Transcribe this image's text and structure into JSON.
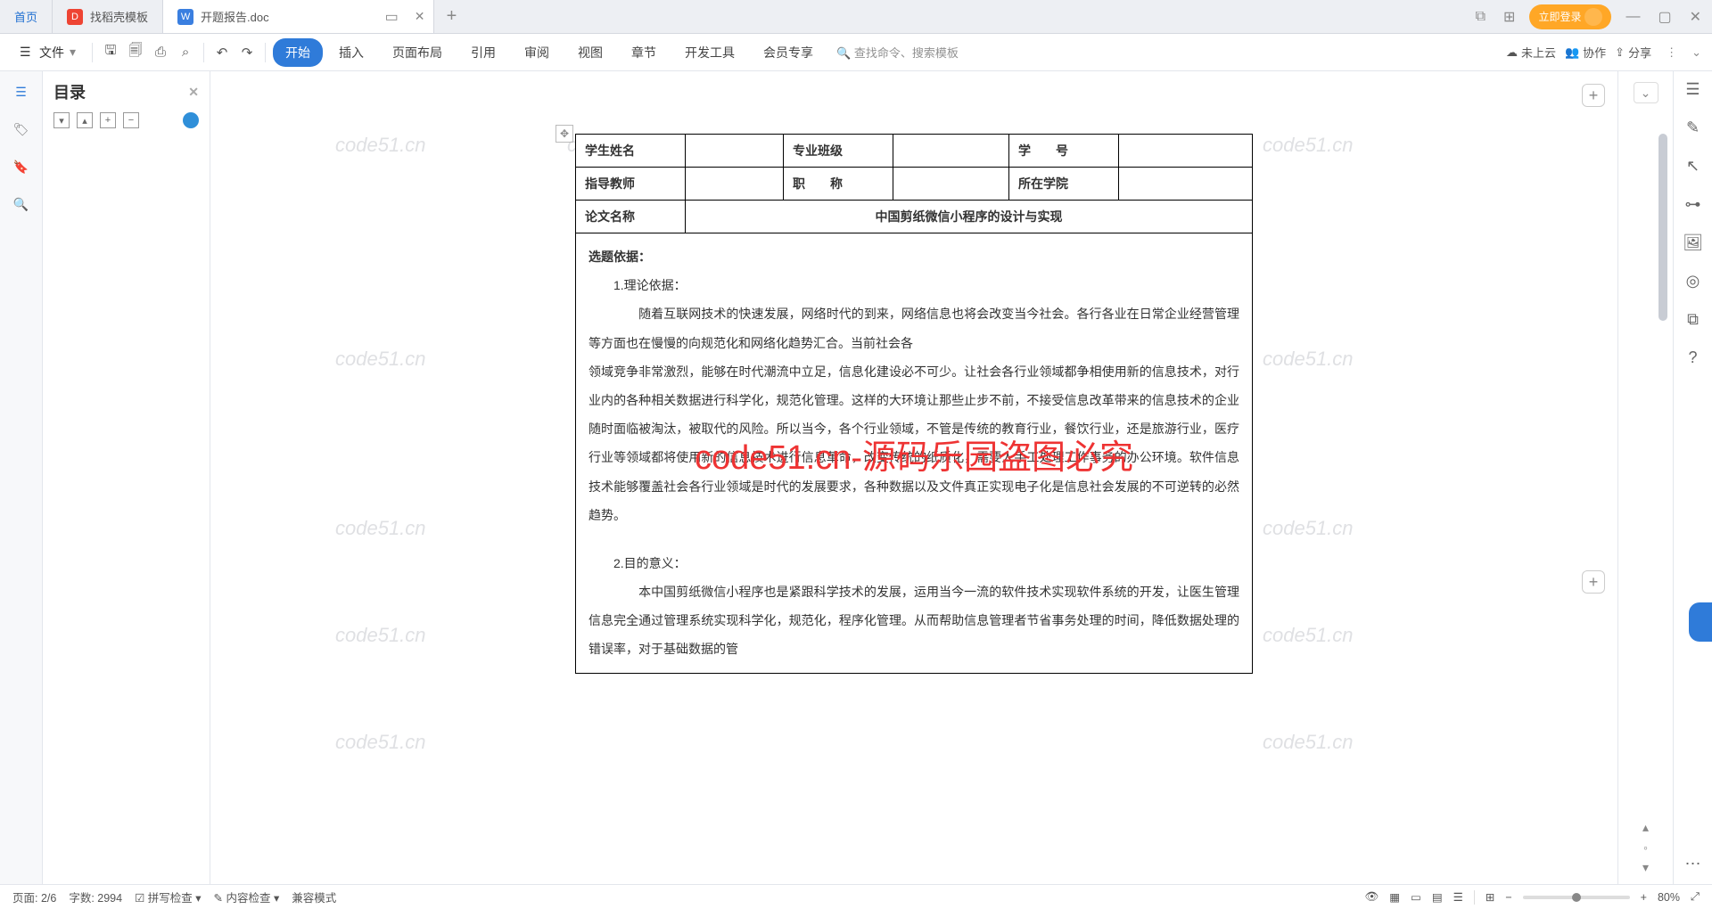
{
  "tabs": {
    "home": "首页",
    "t1": "找稻壳模板",
    "t2": "开题报告.doc",
    "login": "立即登录"
  },
  "ribbon": {
    "file": "文件",
    "items": [
      "开始",
      "插入",
      "页面布局",
      "引用",
      "审阅",
      "视图",
      "章节",
      "开发工具",
      "会员专享"
    ],
    "search_ph": "查找命令、搜索模板",
    "cloud": "未上云",
    "collab": "协作",
    "share": "分享"
  },
  "outline": {
    "title": "目录"
  },
  "doc": {
    "r1": [
      "学生姓名",
      "专业班级",
      "学　　号"
    ],
    "r2": [
      "指导教师",
      "职　　称",
      "所在学院"
    ],
    "thesis_lbl": "论文名称",
    "thesis_title": "中国剪纸微信小程序的设计与实现",
    "basis_lbl": "选题依据：",
    "sec1": "　　1.理论依据：",
    "p1": "　　随着互联网技术的快速发展，网络时代的到来，网络信息也将会改变当今社会。各行各业在日常企业经营管理等方面也在慢慢的向规范化和网络化趋势汇合。当前社会各",
    "p1b": "领域竞争非常激烈，能够在时代潮流中立足，信息化建设必不可少。让社会各行业领域都争相使用新的信息技术，对行业内的各种相关数据进行科学化，规范化管理。这样的大环境让那些止步不前，不接受信息改革带来的信息技术的企业随时面临被淘汰，被取代的风险。所以当今，各个行业领域，不管是传统的教育行业，餐饮行业，还是旅游行业，医疗行业等领域都将使用新的信息技术进行信息革命，改变传统的纸质化，需要人手工处理工作事务的办公环境。软件信息技术能够覆盖社会各行业领域是时代的发展要求，各种数据以及文件真正实现电子化是信息社会发展的不可逆转的必然趋势。",
    "sec2": "　　2.目的意义：",
    "p2": "　　本中国剪纸微信小程序也是紧跟科学技术的发展，运用当今一流的软件技术实现软件系统的开发，让医生管理信息完全通过管理系统实现科学化，规范化，程序化管理。从而帮助信息管理者节省事务处理的时间，降低数据处理的错误率，对于基础数据的管"
  },
  "wm": {
    "text": "code51.cn",
    "red": "code51.cn-源码乐园盗图必究"
  },
  "status": {
    "page": "页面: 2/6",
    "words": "字数: 2994",
    "spell": "拼写检查",
    "content": "内容检查",
    "compat": "兼容模式",
    "zoom": "80%"
  }
}
